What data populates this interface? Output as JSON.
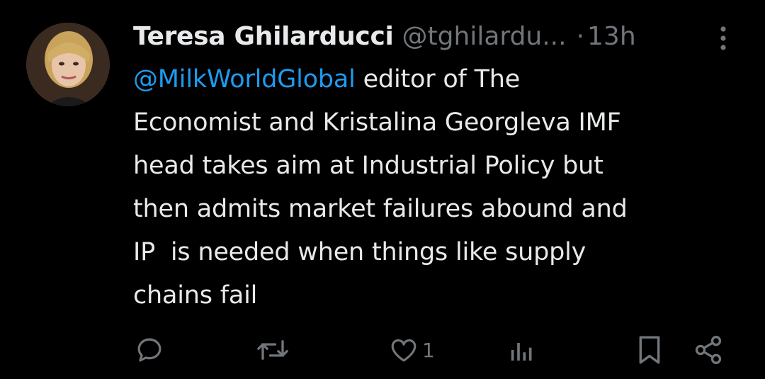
{
  "tweet": {
    "author": {
      "display_name": "Teresa Ghilarducci",
      "handle": "@tghilardu...",
      "separator": "·",
      "time": "13h"
    },
    "body": {
      "mention": "@MilkWorldGlobal",
      "line1_rest": " editor of The",
      "line2": "Economist and Kristalina Georgleva IMF",
      "line3": "head takes aim at Industrial Policy but",
      "line4": "then admits market failures abound and",
      "line5": "IP  is needed when things like supply",
      "line6": "chains fail"
    },
    "actions": {
      "reply_icon": "reply-icon",
      "retweet_icon": "retweet-icon",
      "like_icon": "heart-icon",
      "like_count": "1",
      "views_icon": "views-icon",
      "bookmark_icon": "bookmark-icon",
      "share_icon": "share-icon"
    },
    "more_icon": "more-vertical-icon"
  },
  "colors": {
    "background": "#000000",
    "text": "#e7e9ea",
    "muted": "#71767b",
    "link": "#1d9bf0"
  }
}
